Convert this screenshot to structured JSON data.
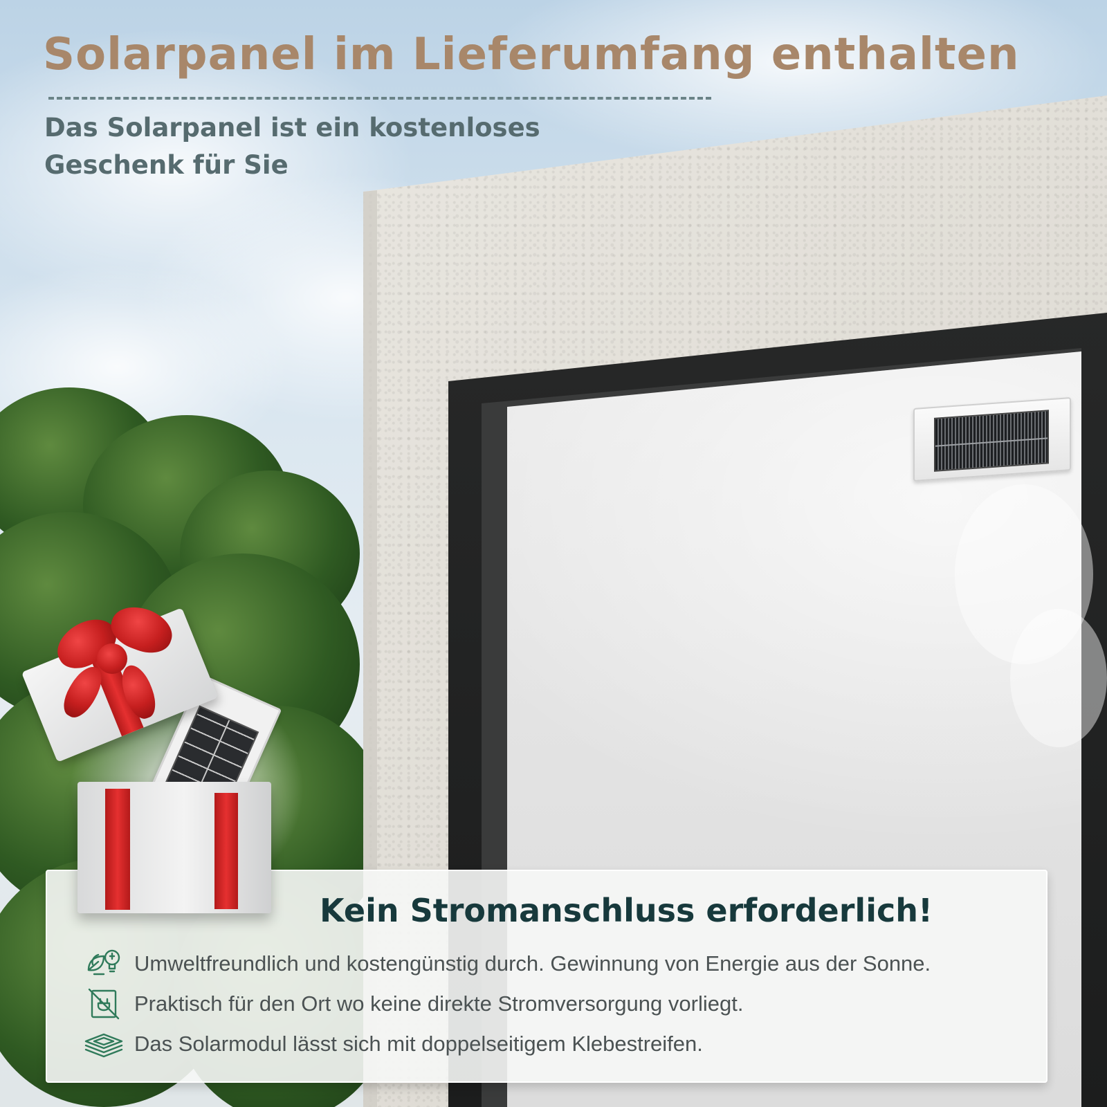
{
  "header": {
    "title": "Solarpanel im Lieferumfang enthalten",
    "subtitle_line1": "Das Solarpanel ist ein kostenloses",
    "subtitle_line2": "Geschenk für Sie"
  },
  "card": {
    "title": "Kein Stromanschluss erforderlich!",
    "features": [
      {
        "icon": "eco-leaf-bulb-icon",
        "text": "Umweltfreundlich und kostengünstig durch. Gewinnung von Energie aus der Sonne."
      },
      {
        "icon": "no-plug-icon",
        "text": "Praktisch für den Ort wo keine direkte Stromversorgung vorliegt."
      },
      {
        "icon": "adhesive-layers-icon",
        "text": "Das Solarmodul lässt sich mit doppelseitigem Klebestreifen."
      }
    ]
  },
  "colors": {
    "title": "#a8876a",
    "subtitle": "#566b6f",
    "card_title": "#17393c",
    "icon": "#2f7a5a",
    "ribbon": "#d42a2a"
  }
}
